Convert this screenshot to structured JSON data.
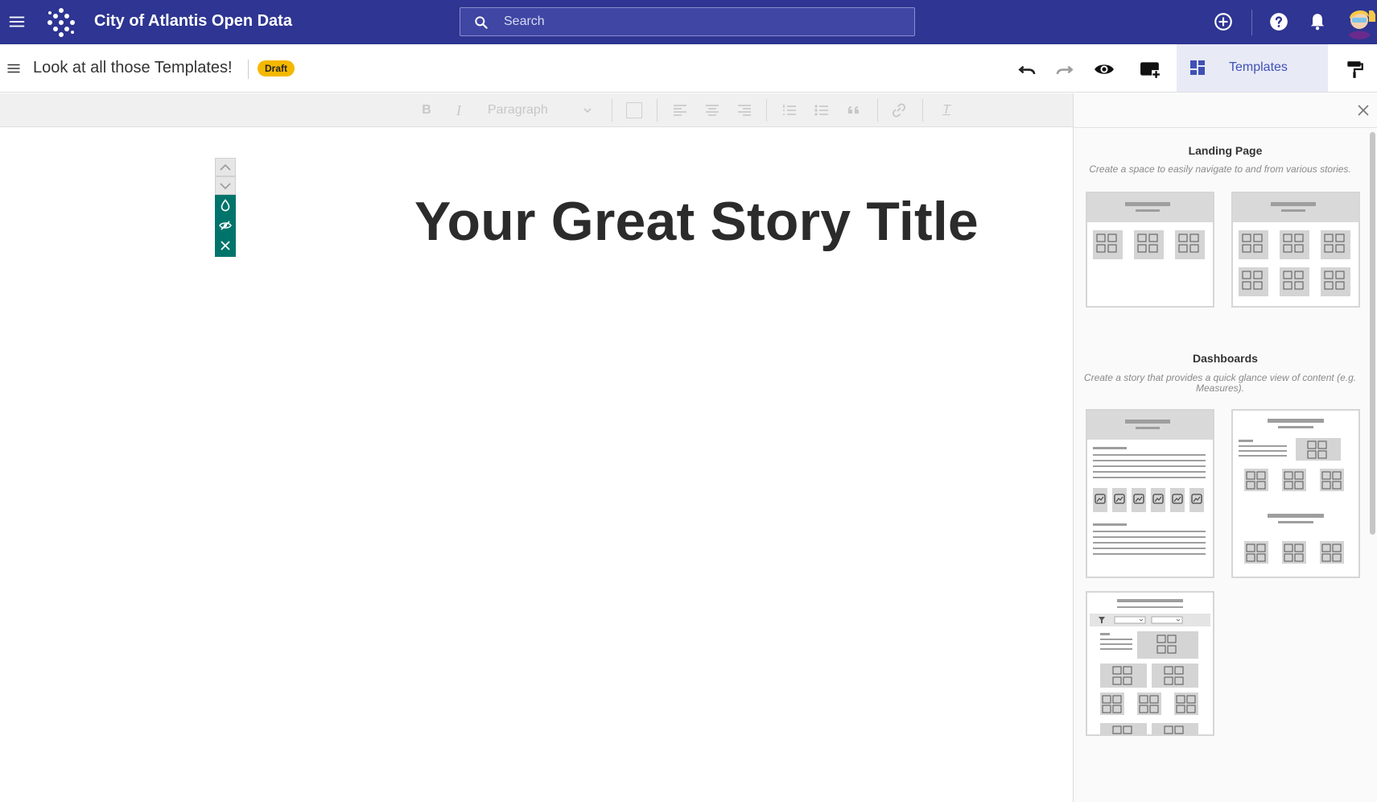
{
  "appbar": {
    "site_title": "City of Atlantis Open Data",
    "search_placeholder": "Search",
    "bg_color": "#2e3592"
  },
  "document": {
    "title": "Look at all those Templates!",
    "status_badge": "Draft",
    "badge_color": "#f5b800"
  },
  "toolbar": {
    "templates_label": "Templates",
    "paragraph_style": "Paragraph"
  },
  "story": {
    "title": "Your Great Story Title"
  },
  "panel": {
    "sections": [
      {
        "title": "Landing Page",
        "description": "Create a space to easily navigate to and from various stories."
      },
      {
        "title": "Dashboards",
        "description": "Create a story that provides a quick glance view of content (e.g. Measures)."
      }
    ]
  },
  "icons": {
    "menu": "menu-icon",
    "logo": "dots-logo-icon",
    "search": "search-icon",
    "add": "add-circle-icon",
    "help": "help-icon",
    "bell": "bell-icon",
    "undo": "undo-icon",
    "redo": "redo-icon",
    "preview": "eye-icon",
    "add_block": "add-block-icon",
    "templates": "dashboard-icon",
    "format_painter": "paint-roller-icon",
    "close": "close-icon"
  }
}
